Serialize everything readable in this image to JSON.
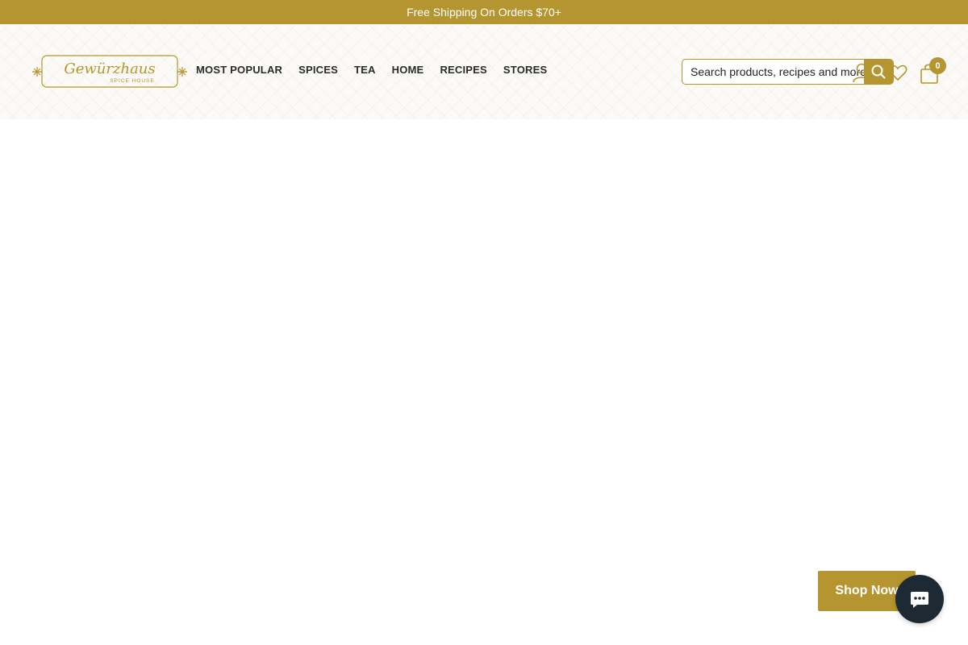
{
  "announcement": {
    "text": "Free Shipping On Orders $70+"
  },
  "logo": {
    "wordmark": "Gewürzhaus",
    "tagline": "SPICE HOUSE"
  },
  "nav": {
    "items": [
      {
        "label": "MOST POPULAR"
      },
      {
        "label": "SPICES"
      },
      {
        "label": "TEA"
      },
      {
        "label": "HOME"
      },
      {
        "label": "RECIPES"
      },
      {
        "label": "STORES"
      }
    ]
  },
  "search": {
    "placeholder": "Search products, recipes and more..."
  },
  "icons": [
    "search-icon",
    "account-icon",
    "heart-icon",
    "bag-icon",
    "chat-icon"
  ],
  "cart": {
    "count": "0"
  },
  "hero": {
    "cta_label": "Shop Now"
  },
  "colors": {
    "brand": "#b5952f",
    "chat": "#1d2a33",
    "text": "#2a2a2a"
  }
}
